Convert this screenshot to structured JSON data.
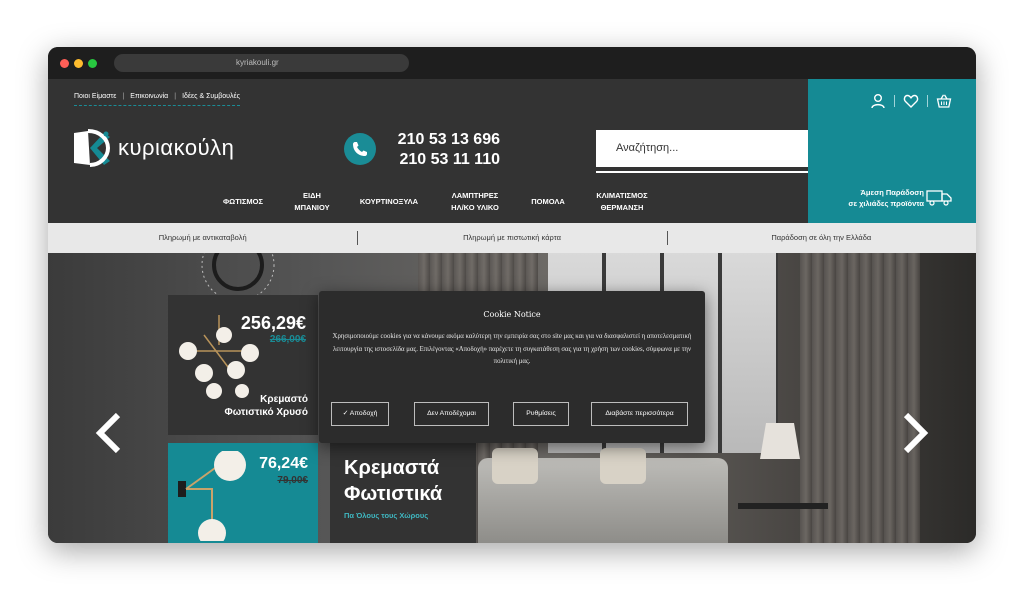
{
  "browser": {
    "url": "kyriakouli.gr"
  },
  "header": {
    "top_links": [
      "Ποιοι Είμαστε",
      "Επικοινωνία",
      "Ιδέες & Συμβουλές"
    ],
    "logo_text": "κυριακούλη",
    "phones": [
      "210 53 13 696",
      "210 53 11 110"
    ],
    "search_placeholder": "Αναζήτηση...",
    "nav": [
      {
        "line1": "ΦΩΤΙΣΜΟΣ",
        "line2": ""
      },
      {
        "line1": "ΕΙΔΗ",
        "line2": "ΜΠΑΝΙΟΥ"
      },
      {
        "line1": "ΚΟΥΡΤΙΝΟΞΥΛΑ",
        "line2": ""
      },
      {
        "line1": "ΛΑΜΠΤΗΡΕΣ",
        "line2": "ΗΛ/ΚΟ ΥΛΙΚΟ"
      },
      {
        "line1": "ΠΟΜΟΛΑ",
        "line2": ""
      },
      {
        "line1": "ΚΛΙΜΑΤΙΣΜΟΣ",
        "line2": "ΘΕΡΜΑΝΣΗ"
      }
    ],
    "delivery_line1": "Άμεση Παράδοση",
    "delivery_line2": "σε χιλιάδες προϊόντα",
    "icons": [
      "user-icon",
      "heart-icon",
      "basket-icon",
      "phone-icon",
      "search-icon",
      "truck-icon"
    ]
  },
  "infobar": [
    "Πληρωμή με αντικαταβολή",
    "Πληρωμή με πιστωτική κάρτα",
    "Παράδοση σε όλη την Ελλάδα"
  ],
  "hero": {
    "promo1": {
      "price": "256,29€",
      "old_price": "266,00€",
      "name_line1": "Κρεμαστό",
      "name_line2": "Φωτιστικό Χρυσό"
    },
    "promo2": {
      "price": "76,24€",
      "old_price": "79,00€"
    },
    "promo3": {
      "title_line1": "Κρεμαστά",
      "title_line2": "Φωτιστικά",
      "subtitle": "Πα Όλους τους Χώρους"
    }
  },
  "cookie": {
    "title": "Cookie Notice",
    "text": "Χρησιμοποιούμε cookies για να κάνουμε ακόμα καλύτερη την εμπειρία σας στο site μας και για να διασφαλιστεί η αποτελεσματική λειτουργία της ιστοσελίδα μας. Επιλέγοντας «Αποδοχή» παρέχετε τη συγκατάθεση σας για τη χρήση των cookies, σύμφωνα με την πολιτική μας.",
    "accept": "✓ Αποδοχή",
    "decline": "Δεν Αποδέχομαι",
    "settings": "Ρυθμίσεις",
    "read_more": "Διαβάστε περισσότερα"
  },
  "colors": {
    "teal": "#158a94",
    "dark": "#333333"
  }
}
